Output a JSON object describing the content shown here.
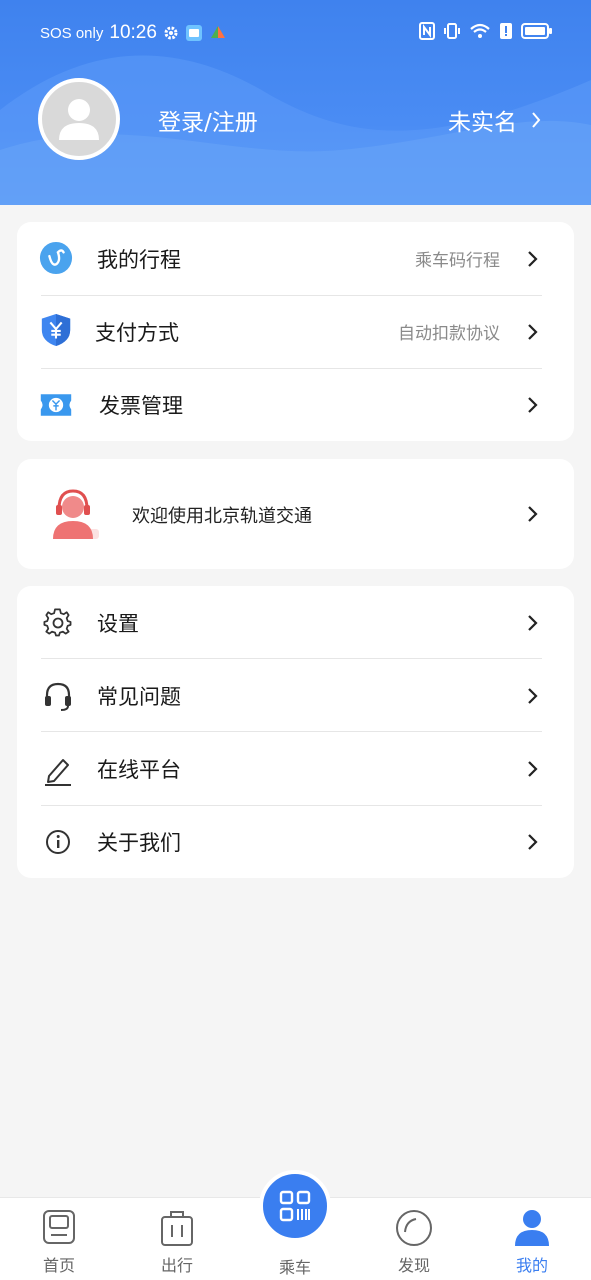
{
  "status_bar": {
    "sos": "SOS only",
    "time": "10:26"
  },
  "header": {
    "login_label": "登录/注册",
    "realname_label": "未实名"
  },
  "card1": [
    {
      "label": "我的行程",
      "sub": "乘车码行程",
      "icon": "trip-icon"
    },
    {
      "label": "支付方式",
      "sub": "自动扣款协议",
      "icon": "payment-shield-icon"
    },
    {
      "label": "发票管理",
      "sub": "",
      "icon": "invoice-ticket-icon"
    }
  ],
  "welcome": {
    "text": "欢迎使用北京轨道交通",
    "icon": "customer-service-avatar-icon"
  },
  "card3": [
    {
      "label": "设置",
      "icon": "gear-icon"
    },
    {
      "label": "常见问题",
      "icon": "headset-icon"
    },
    {
      "label": "在线平台",
      "icon": "edit-icon"
    },
    {
      "label": "关于我们",
      "icon": "info-icon"
    }
  ],
  "nav": [
    {
      "label": "首页",
      "icon": "home-train-icon"
    },
    {
      "label": "出行",
      "icon": "luggage-icon"
    },
    {
      "label": "乘车",
      "icon": "qr-code-icon"
    },
    {
      "label": "发现",
      "icon": "discover-icon"
    },
    {
      "label": "我的",
      "icon": "person-icon"
    }
  ],
  "colors": {
    "primary": "#3a7ef0",
    "header_start": "#3f82ee",
    "text": "#1a1a1a",
    "muted": "#8a8a8a"
  }
}
